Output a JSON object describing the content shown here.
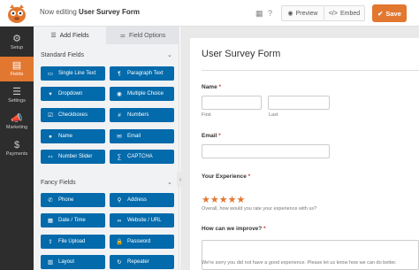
{
  "header": {
    "editing_prefix": "Now editing",
    "form_name": "User Survey Form",
    "preview_label": "Preview",
    "embed_label": "Embed",
    "save_label": "Save",
    "accent_color": "#e27730"
  },
  "leftnav": {
    "items": [
      {
        "label": "Setup",
        "icon": "gear-icon"
      },
      {
        "label": "Fields",
        "icon": "fields-icon"
      },
      {
        "label": "Settings",
        "icon": "sliders-icon"
      },
      {
        "label": "Marketing",
        "icon": "megaphone-icon"
      },
      {
        "label": "Payments",
        "icon": "dollar-icon"
      }
    ]
  },
  "panel": {
    "tabs": [
      "Add Fields",
      "Field Options"
    ],
    "standard_title": "Standard Fields",
    "standard_fields": [
      "Single Line Text",
      "Paragraph Text",
      "Dropdown",
      "Multiple Choice",
      "Checkboxes",
      "Numbers",
      "Name",
      "Email",
      "Number Slider",
      "CAPTCHA"
    ],
    "fancy_title": "Fancy Fields",
    "fancy_fields": [
      "Phone",
      "Address",
      "Date / Time",
      "Website / URL",
      "File Upload",
      "Password",
      "Layout",
      "Repeater"
    ],
    "button_color": "#036aab"
  },
  "form": {
    "title": "User Survey Form",
    "name_label": "Name",
    "first_label": "First",
    "last_label": "Last",
    "email_label": "Email",
    "experience_label": "Your Experience",
    "experience_hint": "Overall, how would you rate your experience with us?",
    "improve_label": "How can we improve?",
    "improve_text": "We're sorry you did not have a good experience. Please let us know how we can do better.",
    "rating_stars": 5
  }
}
